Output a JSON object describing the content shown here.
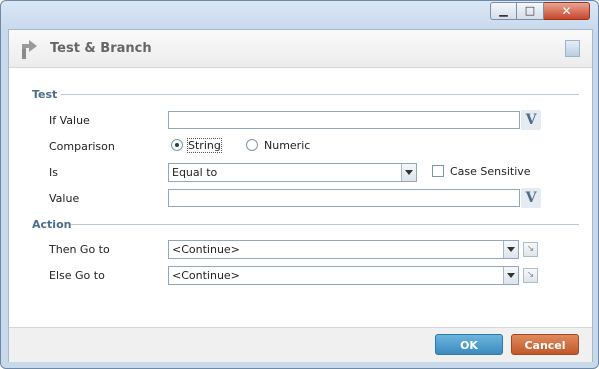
{
  "window": {
    "controls": {
      "minimize": "▁",
      "maximize": "□",
      "close": "✕"
    }
  },
  "header": {
    "title": "Test & Branch",
    "icon": "branch-arrow-icon",
    "note_icon": "note-icon"
  },
  "test_section": {
    "label": "Test",
    "if_value": {
      "label": "If Value",
      "value": ""
    },
    "comparison": {
      "label": "Comparison",
      "options": [
        {
          "label": "String",
          "selected": true
        },
        {
          "label": "Numeric",
          "selected": false
        }
      ]
    },
    "is": {
      "label": "Is",
      "selected": "Equal to"
    },
    "case_sensitive": {
      "label": "Case Sensitive",
      "checked": false
    },
    "value": {
      "label": "Value",
      "value": ""
    },
    "variable_button": "V"
  },
  "action_section": {
    "label": "Action",
    "then_go_to": {
      "label": "Then Go to",
      "selected": "<Continue>"
    },
    "else_go_to": {
      "label": "Else Go to",
      "selected": "<Continue>"
    }
  },
  "footer": {
    "ok_label": "OK",
    "cancel_label": "Cancel",
    "colors": {
      "ok": "#3b8bc0",
      "cancel": "#c2582a"
    }
  }
}
